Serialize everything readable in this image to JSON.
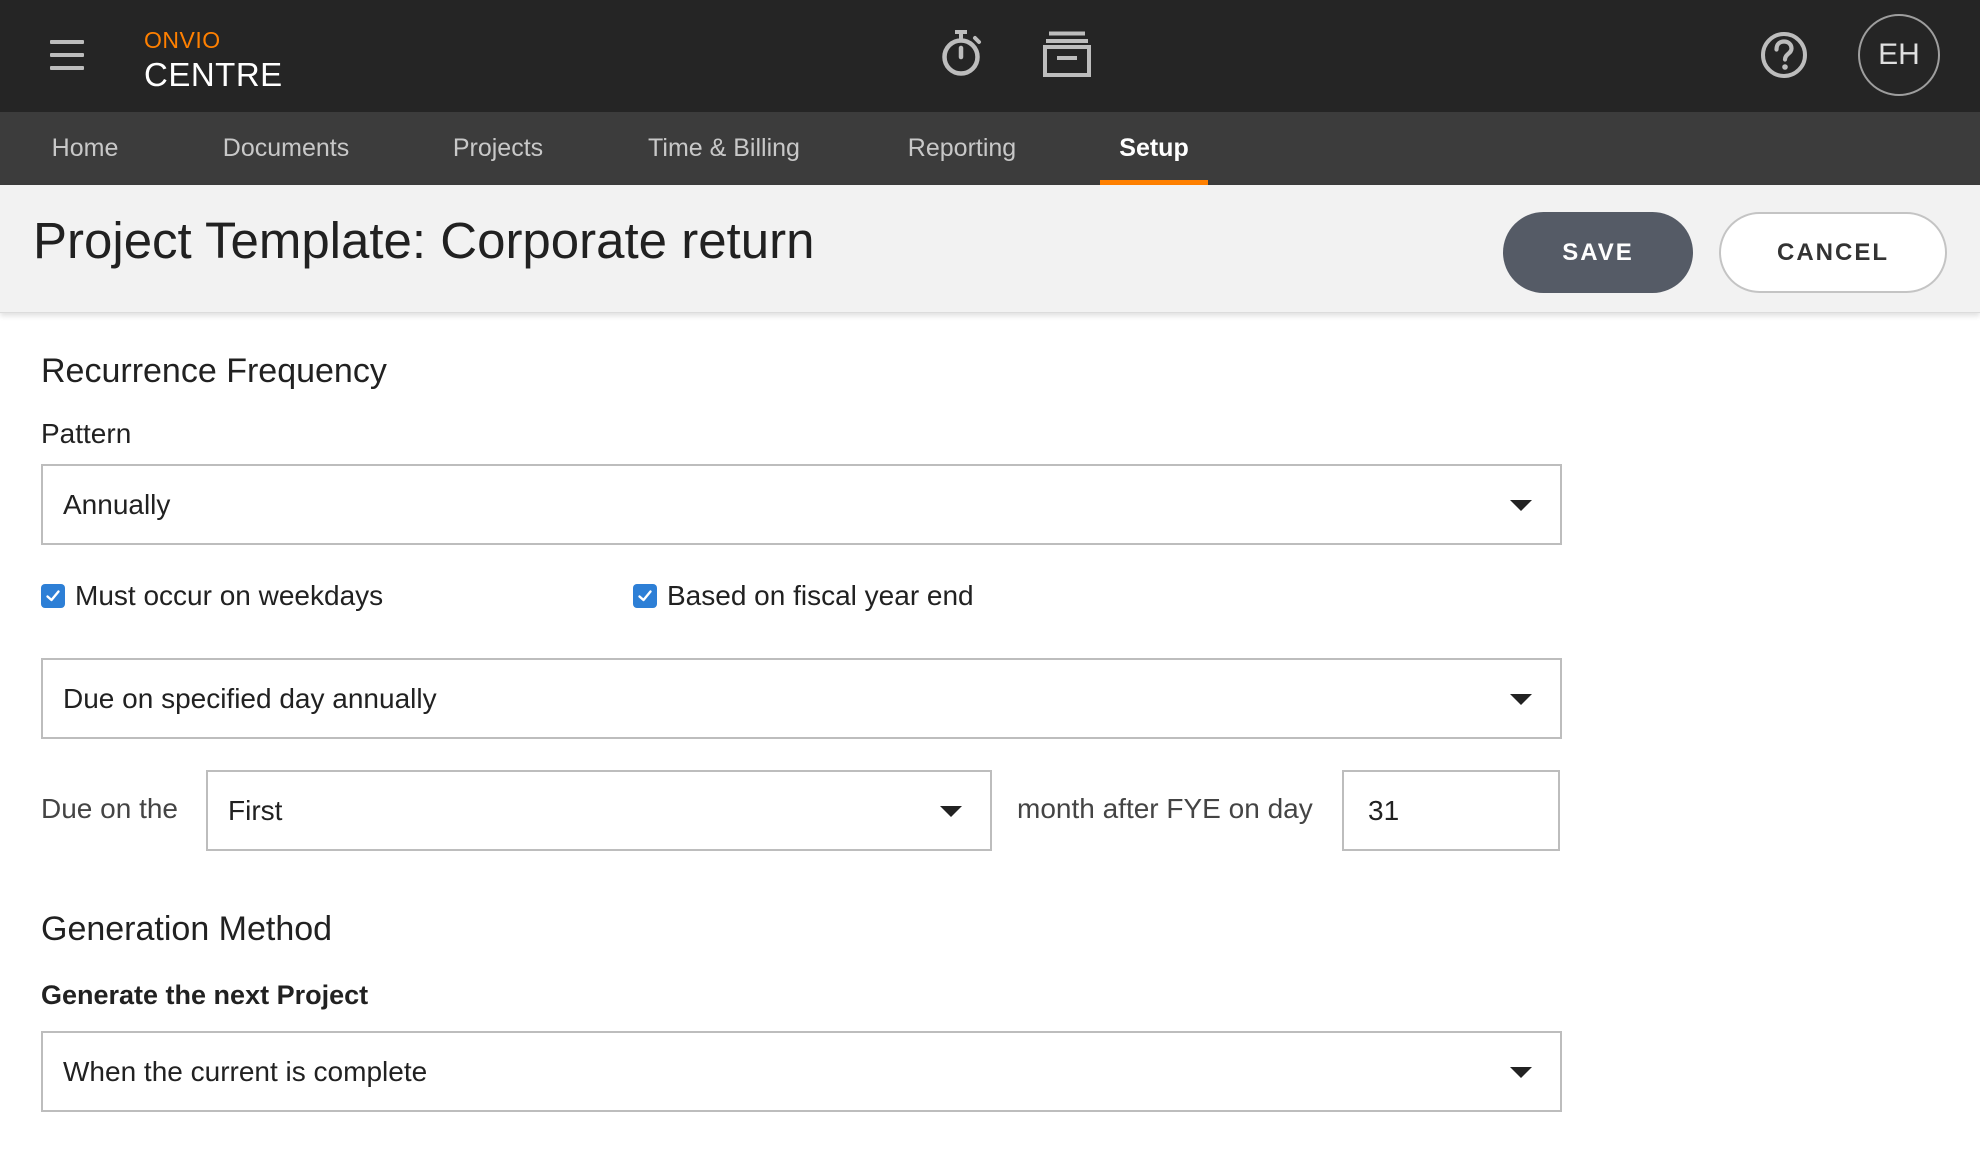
{
  "app": {
    "brand_top": "ONVIO",
    "brand_main": "CENTRE",
    "user_initials": "EH"
  },
  "icons": {
    "menu": "hamburger-menu-icon",
    "timer": "stopwatch-icon",
    "archive": "archive-tray-icon",
    "help": "help-circle-icon"
  },
  "nav": {
    "tabs": [
      {
        "label": "Home"
      },
      {
        "label": "Documents"
      },
      {
        "label": "Projects"
      },
      {
        "label": "Time & Billing"
      },
      {
        "label": "Reporting"
      },
      {
        "label": "Setup",
        "active": true
      }
    ]
  },
  "header": {
    "title": "Project Template: Corporate return",
    "save_label": "SAVE",
    "cancel_label": "CANCEL"
  },
  "recurrence": {
    "section_title": "Recurrence Frequency",
    "pattern_label": "Pattern",
    "pattern_value": "Annually",
    "weekdays_label": "Must occur on weekdays",
    "weekdays_checked": true,
    "fiscal_label": "Based on fiscal year end",
    "fiscal_checked": true,
    "due_type_value": "Due on specified day annually",
    "due_on_label": "Due on the",
    "due_on_value": "First",
    "month_after_label": "month after FYE on day",
    "day_value": "31"
  },
  "generation": {
    "section_title": "Generation Method",
    "label": "Generate the next Project",
    "value": "When the current is complete"
  },
  "colors": {
    "accent": "#ff8000",
    "topbar": "#252525",
    "nav": "#3c3c3c",
    "checkbox": "#2d7fd6",
    "save_button": "#555b66"
  }
}
